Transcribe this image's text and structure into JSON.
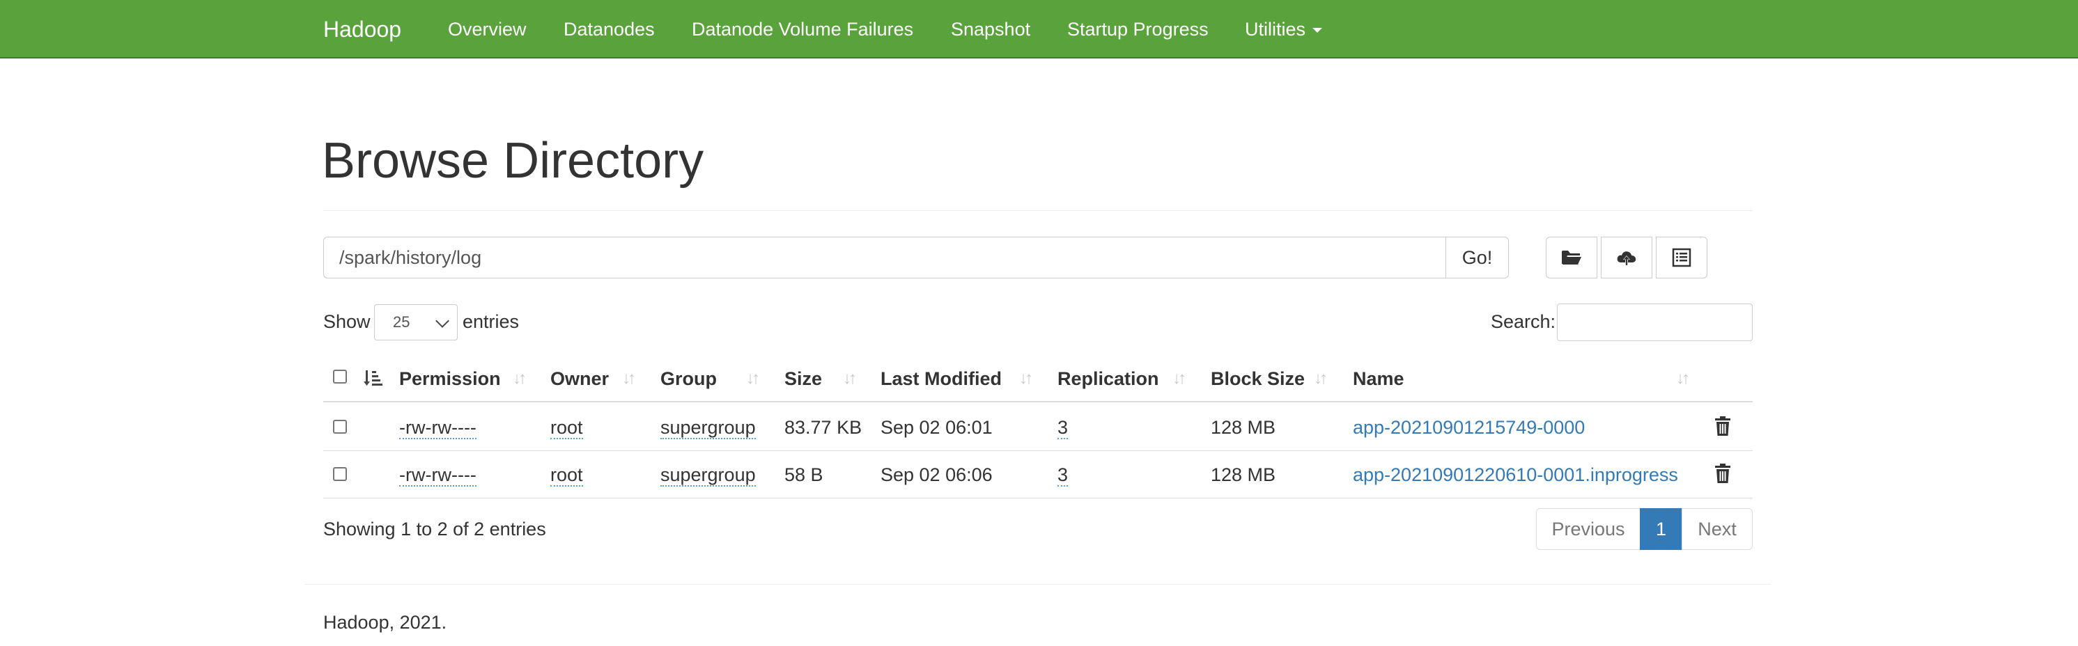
{
  "navbar": {
    "brand": "Hadoop",
    "items": [
      "Overview",
      "Datanodes",
      "Datanode Volume Failures",
      "Snapshot",
      "Startup Progress",
      "Utilities"
    ]
  },
  "page": {
    "title": "Browse Directory"
  },
  "path_bar": {
    "value": "/spark/history/log",
    "go_label": "Go!",
    "icons": [
      "folder-open-icon",
      "cloud-upload-icon",
      "list-alt-icon"
    ]
  },
  "entries": {
    "show_label": "Show",
    "page_size": "25",
    "entries_label": "entries",
    "search_label": "Search:",
    "search_value": ""
  },
  "table": {
    "columns": [
      "Permission",
      "Owner",
      "Group",
      "Size",
      "Last Modified",
      "Replication",
      "Block Size",
      "Name"
    ],
    "rows": [
      {
        "permission": "-rw-rw----",
        "owner": "root",
        "group": "supergroup",
        "size": "83.77 KB",
        "last_modified": "Sep 02 06:01",
        "replication": "3",
        "block_size": "128 MB",
        "name": "app-20210901215749-0000"
      },
      {
        "permission": "-rw-rw----",
        "owner": "root",
        "group": "supergroup",
        "size": "58 B",
        "last_modified": "Sep 02 06:06",
        "replication": "3",
        "block_size": "128 MB",
        "name": "app-20210901220610-0001.inprogress"
      }
    ]
  },
  "pagination": {
    "info": "Showing 1 to 2 of 2 entries",
    "previous": "Previous",
    "current": "1",
    "next": "Next"
  },
  "footer": {
    "text": "Hadoop, 2021."
  },
  "colors": {
    "navbar": "#5aa23b",
    "link": "#337ab7",
    "active_page": "#337ab7"
  }
}
